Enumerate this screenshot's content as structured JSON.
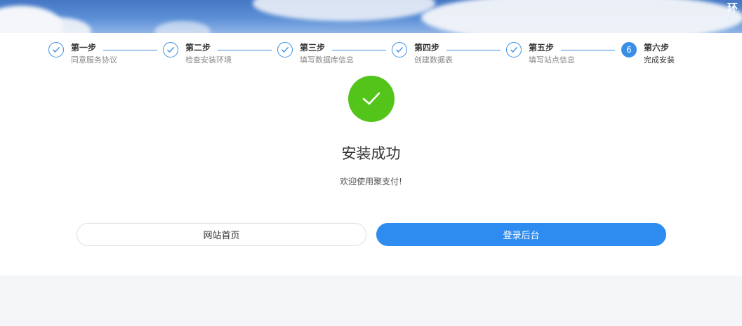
{
  "banner": {
    "corner_text": "环"
  },
  "steps": [
    {
      "title": "第一步",
      "desc": "同意服务协议",
      "state": "done",
      "icon": "check-icon"
    },
    {
      "title": "第二步",
      "desc": "检查安装环境",
      "state": "done",
      "icon": "check-icon"
    },
    {
      "title": "第三步",
      "desc": "填写数据库信息",
      "state": "done",
      "icon": "check-icon"
    },
    {
      "title": "第四步",
      "desc": "创建数据表",
      "state": "done",
      "icon": "check-icon"
    },
    {
      "title": "第五步",
      "desc": "填写站点信息",
      "state": "done",
      "icon": "check-icon"
    },
    {
      "title": "第六步",
      "desc": "完成安装",
      "state": "active",
      "number": "6"
    }
  ],
  "result": {
    "icon": "check-circle-icon",
    "title": "安装成功",
    "subtitle": "欢迎使用聚支付!"
  },
  "buttons": {
    "home_label": "网站首页",
    "admin_label": "登录后台"
  },
  "colors": {
    "primary": "#2e8cf0",
    "success": "#52c41a",
    "page_bg": "#f5f6f8"
  }
}
